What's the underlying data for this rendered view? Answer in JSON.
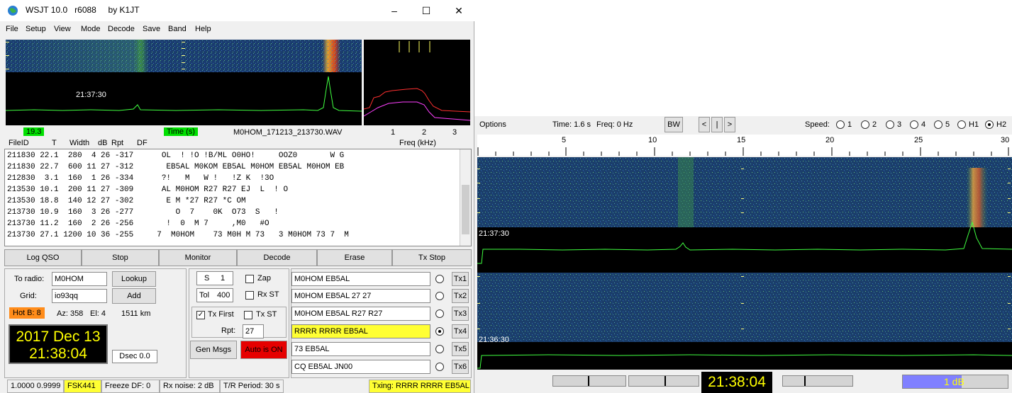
{
  "app": {
    "title": "WSJT 10.0",
    "revision": "r6088",
    "author": "by K1JT",
    "window_buttons": [
      "–",
      "☐",
      "✕"
    ]
  },
  "menu": [
    "File",
    "Setup",
    "View",
    "Mode",
    "Decode",
    "Save",
    "Band",
    "Help"
  ],
  "spectrum": {
    "time_label": "21:37:30",
    "df_value": "19.3",
    "time_button": "Time (s)",
    "filename": "M0HOM_171213_213730.WAV",
    "freq_ticks": [
      "1",
      "2",
      "3"
    ],
    "freq_label": "Freq (kHz)"
  },
  "decode_header": [
    "FileID",
    "T",
    "Width",
    "dB",
    "Rpt",
    "DF"
  ],
  "decode_rows": [
    "211830 22.1  280  4 26 -317      OL  ! !O !B/ML O0HO!     OOZ0       W G",
    "211830 22.7  600 11 27 -312       EB5AL M0KOM EB5AL M0HOM EB5AL M0HOM EB",
    "212830  3.1  160  1 26 -334      ?!   M   W !   !Z K  !3O",
    "213530 10.1  200 11 27 -309      AL M0HOM R27 R27 EJ  L  ! O",
    "213530 18.8  140 12 27 -302       E M *27 R27 *C OM",
    "213730 10.9  160  3 26 -277         O  7    0K  O73  S   !",
    "213730 11.2  160  2 26 -256       !  0  M 7     ,M0   #O",
    "213730 27.1 1200 10 36 -255     7  M0HOM    73 M0H M 73   3 M0HOM 73 7  M"
  ],
  "buttons": {
    "log_qso": "Log QSO",
    "stop": "Stop",
    "monitor": "Monitor",
    "decode": "Decode",
    "erase": "Erase",
    "tx_stop": "Tx Stop"
  },
  "station": {
    "to_radio_label": "To radio:",
    "to_radio_value": "M0HOM",
    "lookup": "Lookup",
    "grid_label": "Grid:",
    "grid_value": "io93qq",
    "add": "Add",
    "hot_b": "Hot B: 8",
    "az": "Az: 358",
    "el": "El: 4",
    "dist": "1511 km",
    "date": "2017 Dec 13",
    "time": "21:38:04",
    "dsec": "Dsec  0.0"
  },
  "controls": {
    "s_label": "S",
    "s_value": "1",
    "tol_label": "Tol",
    "tol_value": "400",
    "zap": "Zap",
    "rx_st": "Rx ST",
    "tx_first": "Tx First",
    "tx_st": "Tx ST",
    "rpt_label": "Rpt:",
    "rpt_value": "27",
    "gen_msgs": "Gen Msgs",
    "auto_is_on": "Auto is  ON"
  },
  "messages": [
    {
      "text": "M0HOM EB5AL",
      "btn": "Tx1"
    },
    {
      "text": "M0HOM EB5AL 27 27",
      "btn": "Tx2"
    },
    {
      "text": "M0HOM EB5AL R27 R27",
      "btn": "Tx3"
    },
    {
      "text": "RRRR RRRR EB5AL",
      "btn": "Tx4"
    },
    {
      "text": "73 EB5AL",
      "btn": "Tx5"
    },
    {
      "text": "CQ EB5AL JN00",
      "btn": "Tx6"
    }
  ],
  "status": {
    "ratio": "1.0000  0.9999",
    "mode": "FSK441",
    "freeze": "Freeze DF:  0",
    "rx_noise": "Rx noise:  2 dB",
    "tr_period": "T/R Period: 30 s",
    "txing": "Txing:  RRRR RRRR EB5AL"
  },
  "waterfall": {
    "options": "Options",
    "time": "Time:  1.6 s",
    "freq": "Freq:  0 Hz",
    "bw": "BW",
    "nav": [
      "<",
      "|",
      ">"
    ],
    "speed_label": "Speed:",
    "speeds": [
      "1",
      "2",
      "3",
      "4",
      "5",
      "H1",
      "H2"
    ],
    "ticks": [
      "5",
      "10",
      "15",
      "20",
      "25",
      "30"
    ],
    "time1": "21:37:30",
    "time2": "21:36:30",
    "clock": "21:38:04",
    "level": "1 dB"
  },
  "colors": {
    "hot_b": "#ff8c1a",
    "auto_on": "#e60000",
    "highlight": "#ffff33",
    "clock_fg": "#ffff00",
    "trace": "#40ff40",
    "level_bar": "#8080ff"
  }
}
